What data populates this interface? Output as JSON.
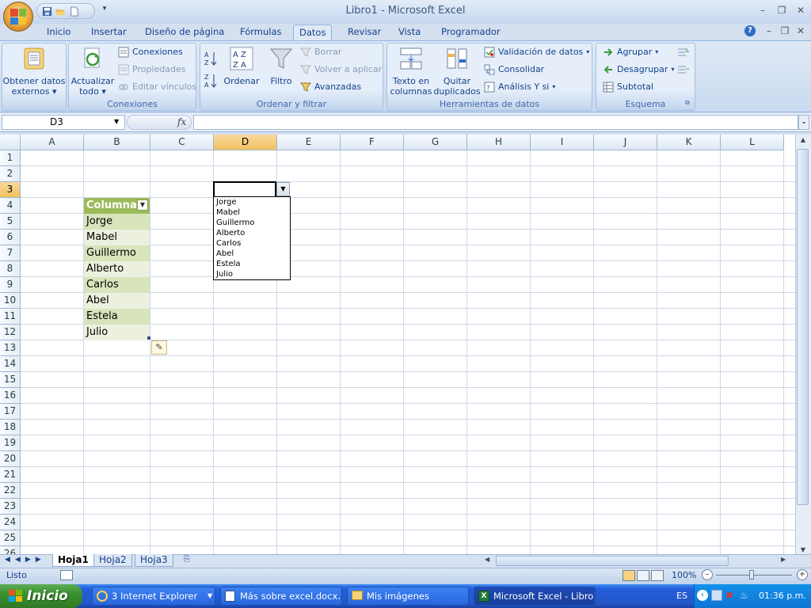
{
  "app": {
    "title": "Libro1 - Microsoft Excel"
  },
  "tabs": [
    "Inicio",
    "Insertar",
    "Diseño de página",
    "Fórmulas",
    "Datos",
    "Revisar",
    "Vista",
    "Programador"
  ],
  "active_tab": "Datos",
  "ribbon": {
    "obtener": {
      "line1": "Obtener datos",
      "line2": "externos"
    },
    "conexiones_group": {
      "label": "Conexiones",
      "actualizar_line1": "Actualizar",
      "actualizar_line2": "todo",
      "conexiones": "Conexiones",
      "propiedades": "Propiedades",
      "editar": "Editar vínculos"
    },
    "ordenar_group": {
      "label": "Ordenar y filtrar",
      "ordenar": "Ordenar",
      "filtro": "Filtro",
      "borrar": "Borrar",
      "volver": "Volver a aplicar",
      "avanzadas": "Avanzadas"
    },
    "herramientas_group": {
      "label": "Herramientas de datos",
      "texto_line1": "Texto en",
      "texto_line2": "columnas",
      "quitar_line1": "Quitar",
      "quitar_line2": "duplicados",
      "validacion": "Validación de datos",
      "consolidar": "Consolidar",
      "analisis": "Análisis Y si"
    },
    "esquema_group": {
      "label": "Esquema",
      "agrupar": "Agrupar",
      "desagrupar": "Desagrupar",
      "subtotal": "Subtotal"
    }
  },
  "formula_bar": {
    "name_box": "D3",
    "fx": "fx",
    "formula": ""
  },
  "sheet": {
    "columns": [
      "A",
      "B",
      "C",
      "D",
      "E",
      "F",
      "G",
      "H",
      "I",
      "J",
      "K",
      "L"
    ],
    "selected_column": "D",
    "rows": [
      "1",
      "2",
      "3",
      "4",
      "5",
      "6",
      "7",
      "8",
      "9",
      "10",
      "11",
      "12",
      "13",
      "14",
      "15",
      "16",
      "17",
      "18",
      "19",
      "20",
      "21",
      "22",
      "23",
      "24",
      "25",
      "26"
    ],
    "selected_row": "3",
    "table_header": "Columna1",
    "table_values": [
      "Jorge",
      "Mabel",
      "Guillermo",
      "Alberto",
      "Carlos",
      "Abel",
      "Estela",
      "Julio"
    ]
  },
  "dropdown": {
    "items": [
      "Jorge",
      "Mabel",
      "Guillermo",
      "Alberto",
      "Carlos",
      "Abel",
      "Estela",
      "Julio"
    ]
  },
  "sheet_tabs": [
    "Hoja1",
    "Hoja2",
    "Hoja3"
  ],
  "active_sheet": "Hoja1",
  "status": {
    "ready": "Listo",
    "zoom": "100%"
  },
  "taskbar": {
    "start": "Inicio",
    "items": [
      "3 Internet Explorer",
      "Más sobre excel.docx...",
      "Mis imágenes",
      "Microsoft Excel - Libro1"
    ],
    "lang": "ES",
    "clock": "01:36 p.m."
  },
  "colors": {
    "table_header": "#9bbb59",
    "table_band_dark": "#d7e4bc",
    "table_band_light": "#ebf1de",
    "selected_header": "#f5c96b",
    "taskbar": "#245edb",
    "start": "#3c8f31"
  }
}
